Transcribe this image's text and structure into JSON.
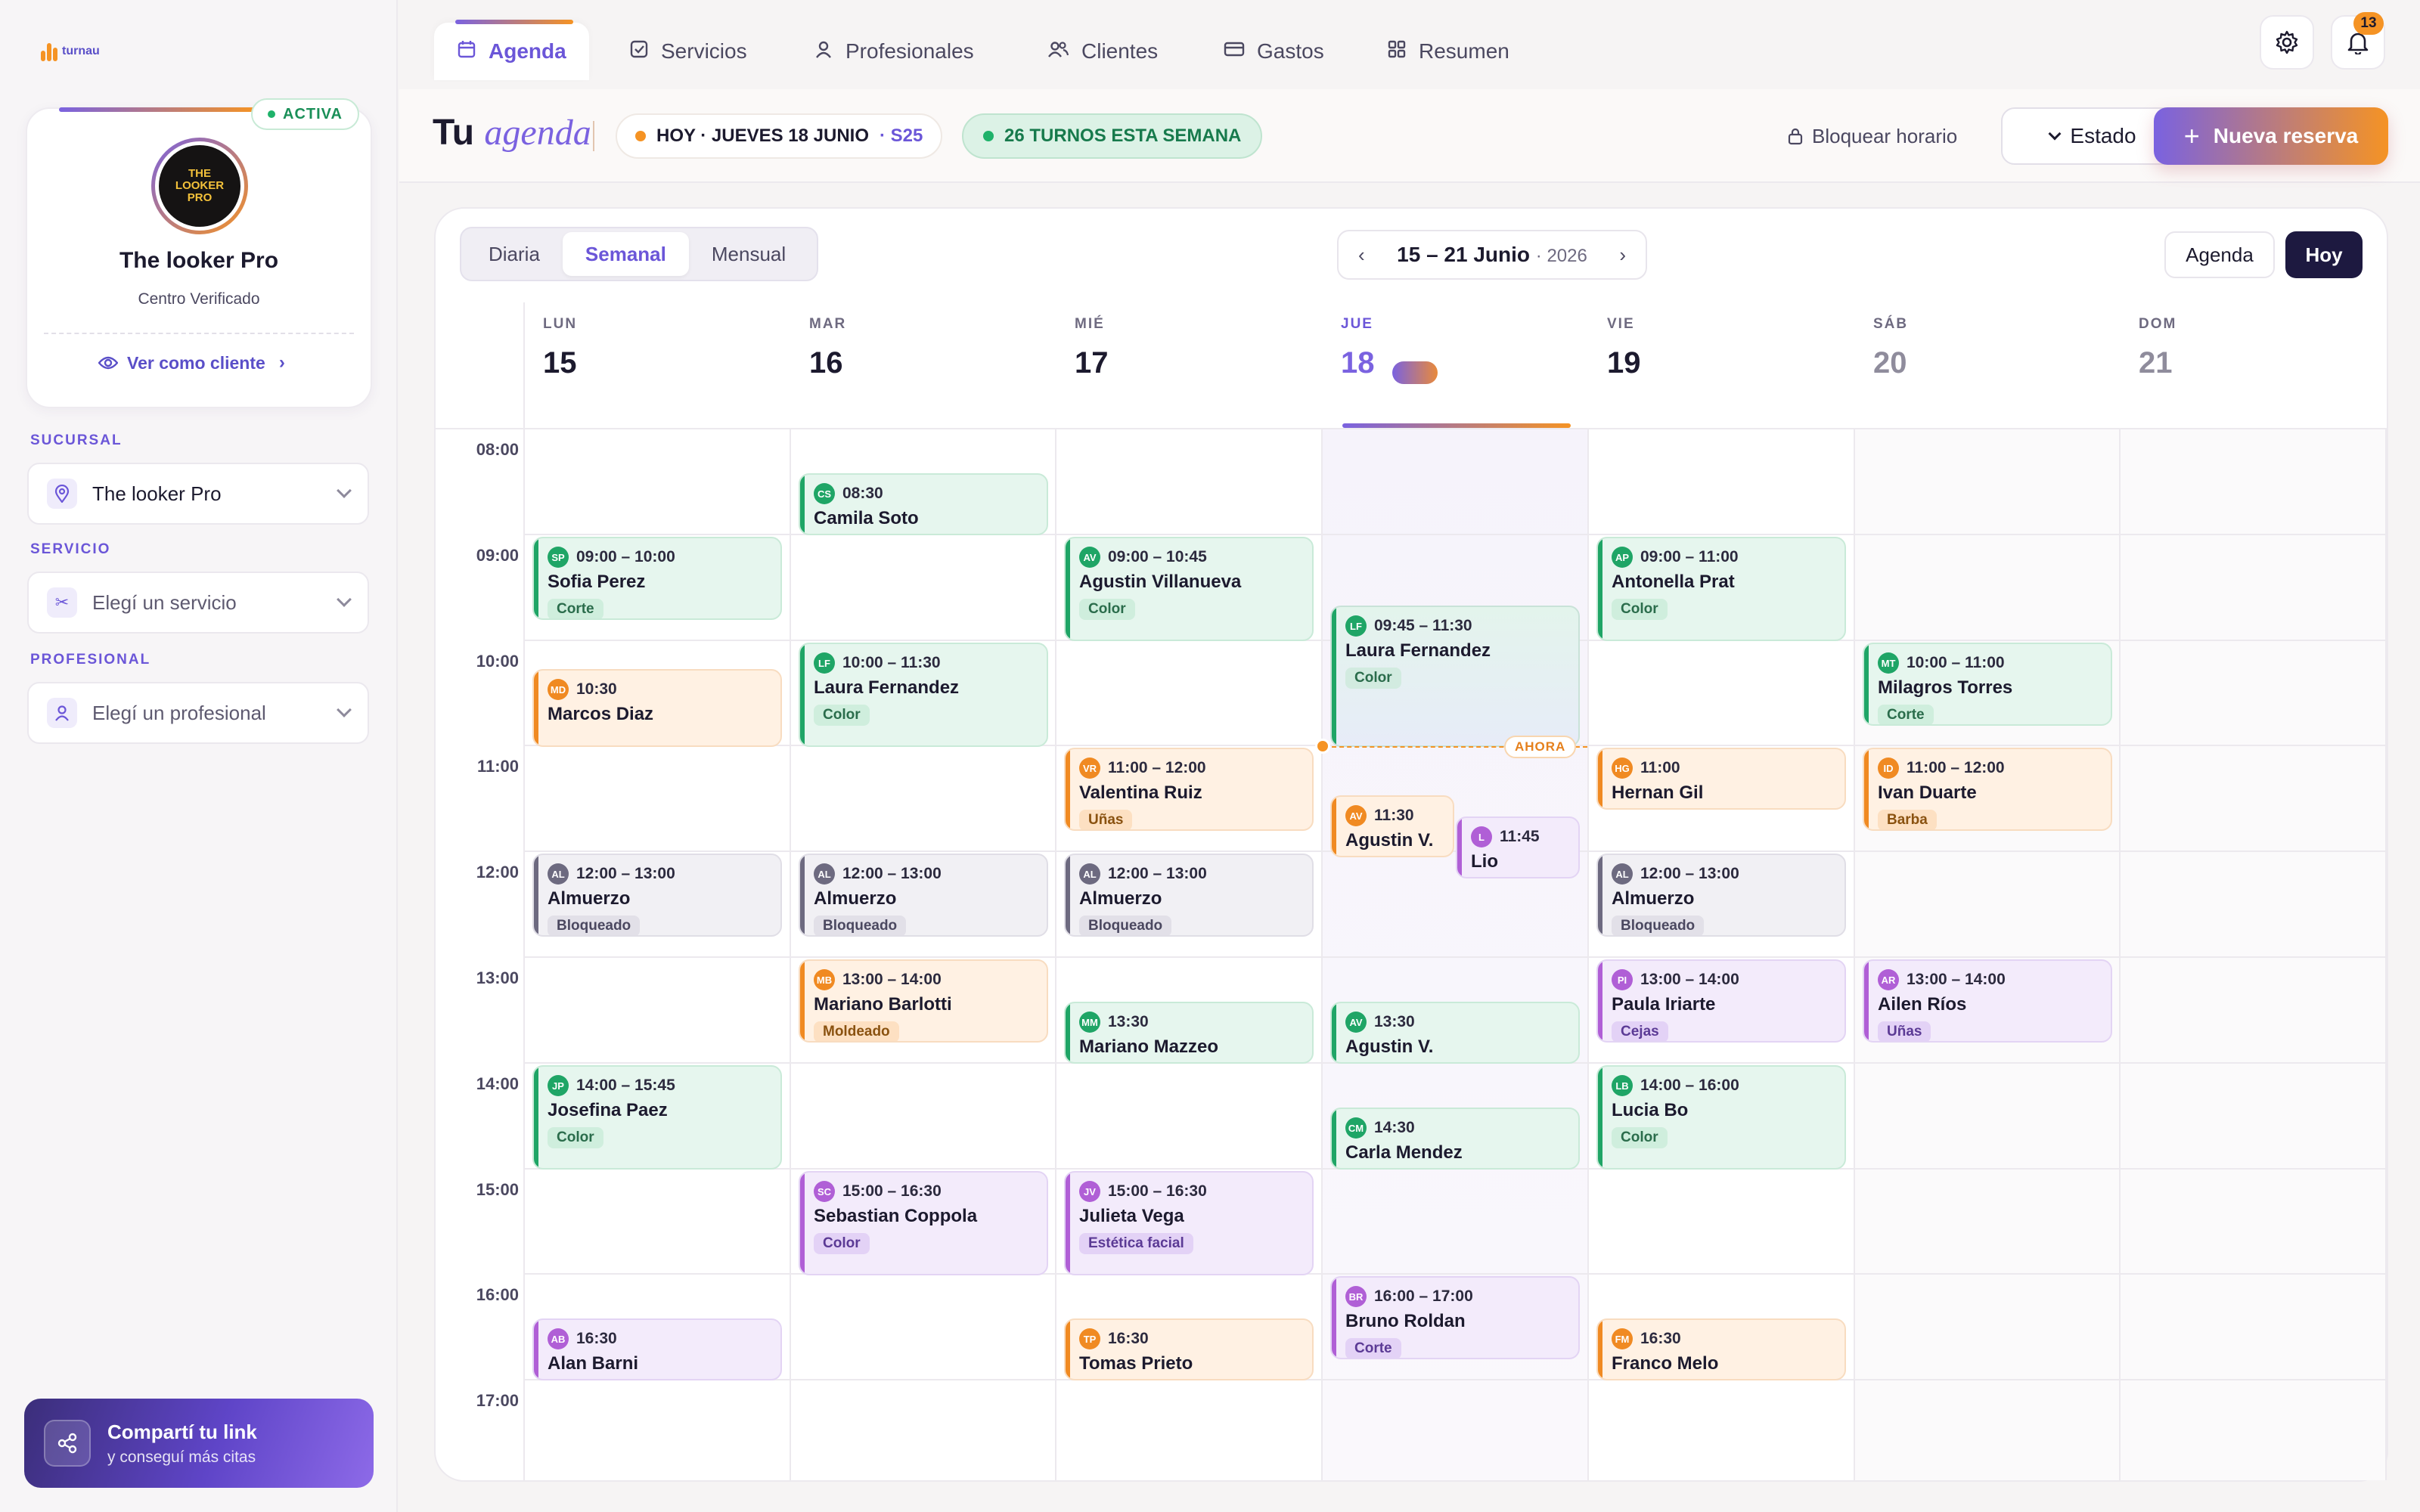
{
  "brand": {
    "name": "turnau"
  },
  "profile": {
    "status": "ACTIVA",
    "avatar_text": [
      "THE",
      "LOOKER",
      "PRO"
    ],
    "name": "The looker Pro",
    "subtitle": "Centro Verificado",
    "see_as_client": "Ver como cliente"
  },
  "filters": {
    "branch_label": "SUCURSAL",
    "branch_value": "The looker Pro",
    "service_label": "SERVICIO",
    "service_placeholder": "Elegí un servicio",
    "pro_label": "PROFESIONAL",
    "pro_placeholder": "Elegí un profesional"
  },
  "share": {
    "title": "Compartí tu link",
    "subtitle": "y conseguí más citas"
  },
  "nav": {
    "tabs": [
      {
        "label": "Agenda",
        "icon": "calendar-icon",
        "active": true
      },
      {
        "label": "Servicios",
        "icon": "checkbox-icon"
      },
      {
        "label": "Profesionales",
        "icon": "person-icon"
      },
      {
        "label": "Clientes",
        "icon": "people-icon"
      },
      {
        "label": "Gastos",
        "icon": "card-icon"
      },
      {
        "label": "Resumen",
        "icon": "grid-icon"
      }
    ],
    "notifications": "13"
  },
  "header": {
    "title_main": "Tu",
    "title_italic": "agenda",
    "today_text": "HOY · JUEVES 18 JUNIO",
    "week_code": "· S25",
    "week_turns": "26 TURNOS ESTA SEMANA",
    "block_label": "Bloquear horario",
    "estado_label": "Estado",
    "new_label": "Nueva reserva"
  },
  "calendar": {
    "views": [
      "Diaria",
      "Semanal",
      "Mensual"
    ],
    "active_view": "Semanal",
    "range": "15 – 21 Junio",
    "year": "· 2026",
    "agenda_btn": "Agenda",
    "hoy_btn": "Hoy",
    "now_label": "AHORA",
    "days": [
      {
        "abbr": "LUN",
        "num": "15"
      },
      {
        "abbr": "MAR",
        "num": "16"
      },
      {
        "abbr": "MIÉ",
        "num": "17"
      },
      {
        "abbr": "JUE",
        "num": "18",
        "today": true
      },
      {
        "abbr": "VIE",
        "num": "19"
      },
      {
        "abbr": "SÁB",
        "num": "20",
        "weekend": true
      },
      {
        "abbr": "DOM",
        "num": "21",
        "weekend": true
      }
    ],
    "hours": [
      "08:00",
      "09:00",
      "10:00",
      "11:00",
      "12:00",
      "13:00",
      "14:00",
      "15:00",
      "16:00",
      "17:00"
    ],
    "events": [
      {
        "day": 0,
        "start": 9.0,
        "end": 9.8,
        "time": "09:00 – 10:00",
        "initials": "SP",
        "name": "Sofia Perez",
        "tag": "Corte",
        "color": "green"
      },
      {
        "day": 0,
        "start": 10.25,
        "end": 11.0,
        "time": "10:30",
        "initials": "MD",
        "name": "Marcos Diaz",
        "color": "orange"
      },
      {
        "day": 0,
        "start": 12.0,
        "end": 12.8,
        "time": "12:00 – 13:00",
        "initials": "AL",
        "name": "Almuerzo",
        "tag": "Bloqueado",
        "color": "gray"
      },
      {
        "day": 0,
        "start": 14.0,
        "end": 15.0,
        "time": "14:00 – 15:45",
        "initials": "JP",
        "name": "Josefina Paez",
        "tag": "Color",
        "color": "green"
      },
      {
        "day": 0,
        "start": 16.4,
        "end": 17.0,
        "time": "16:30",
        "initials": "AB",
        "name": "Alan Barni",
        "color": "purple"
      },
      {
        "day": 1,
        "start": 8.4,
        "end": 9.0,
        "time": "08:30",
        "initials": "CS",
        "name": "Camila Soto",
        "color": "green"
      },
      {
        "day": 1,
        "start": 10.0,
        "end": 11.0,
        "time": "10:00 – 11:30",
        "initials": "LF",
        "name": "Laura Fernandez",
        "tag": "Color",
        "color": "green"
      },
      {
        "day": 1,
        "start": 12.0,
        "end": 12.8,
        "time": "12:00 – 13:00",
        "initials": "AL",
        "name": "Almuerzo",
        "tag": "Bloqueado",
        "color": "gray"
      },
      {
        "day": 1,
        "start": 13.0,
        "end": 13.8,
        "time": "13:00 – 14:00",
        "initials": "MB",
        "name": "Mariano Barlotti",
        "tag": "Moldeado",
        "color": "orange"
      },
      {
        "day": 1,
        "start": 15.0,
        "end": 16.0,
        "time": "15:00 – 16:30",
        "initials": "SC",
        "name": "Sebastian Coppola",
        "tag": "Color",
        "color": "purple"
      },
      {
        "day": 2,
        "start": 9.0,
        "end": 10.0,
        "time": "09:00 – 10:45",
        "initials": "AV",
        "name": "Agustin Villanueva",
        "tag": "Color",
        "color": "green"
      },
      {
        "day": 2,
        "start": 11.0,
        "end": 11.8,
        "time": "11:00 – 12:00",
        "initials": "VR",
        "name": "Valentina Ruiz",
        "tag": "Uñas",
        "color": "orange"
      },
      {
        "day": 2,
        "start": 12.0,
        "end": 12.8,
        "time": "12:00 – 13:00",
        "initials": "AL",
        "name": "Almuerzo",
        "tag": "Bloqueado",
        "color": "gray"
      },
      {
        "day": 2,
        "start": 13.4,
        "end": 14.0,
        "time": "13:30",
        "initials": "MM",
        "name": "Mariano Mazzeo",
        "color": "green"
      },
      {
        "day": 2,
        "start": 15.0,
        "end": 16.0,
        "time": "15:00 – 16:30",
        "initials": "JV",
        "name": "Julieta Vega",
        "tag": "Estética facial",
        "color": "purple"
      },
      {
        "day": 2,
        "start": 16.4,
        "end": 17.0,
        "time": "16:30",
        "initials": "TP",
        "name": "Tomas Prieto",
        "color": "orange"
      },
      {
        "day": 3,
        "start": 9.65,
        "end": 11.0,
        "time": "09:45 – 11:30",
        "initials": "LF",
        "name": "Laura Fernandez",
        "tag": "Color",
        "color": "green-blue"
      },
      {
        "day": 3,
        "start": 11.45,
        "end": 12.05,
        "time": "11:30",
        "initials": "AV",
        "name": "Agustin V.",
        "color": "orange",
        "half": "left"
      },
      {
        "day": 3,
        "start": 11.65,
        "end": 12.25,
        "time": "11:45",
        "initials": "L",
        "name": "Lio",
        "color": "purple",
        "half": "right"
      },
      {
        "day": 3,
        "start": 13.4,
        "end": 14.0,
        "time": "13:30",
        "initials": "AV",
        "name": "Agustin V.",
        "color": "green"
      },
      {
        "day": 3,
        "start": 14.4,
        "end": 15.0,
        "time": "14:30",
        "initials": "CM",
        "name": "Carla Mendez",
        "color": "green"
      },
      {
        "day": 3,
        "start": 16.0,
        "end": 16.8,
        "time": "16:00 – 17:00",
        "initials": "BR",
        "name": "Bruno Roldan",
        "tag": "Corte",
        "color": "purple"
      },
      {
        "day": 4,
        "start": 9.0,
        "end": 10.0,
        "time": "09:00 – 11:00",
        "initials": "AP",
        "name": "Antonella Prat",
        "tag": "Color",
        "color": "green"
      },
      {
        "day": 4,
        "start": 11.0,
        "end": 11.6,
        "time": "11:00",
        "initials": "HG",
        "name": "Hernan Gil",
        "color": "orange"
      },
      {
        "day": 4,
        "start": 12.0,
        "end": 12.8,
        "time": "12:00 – 13:00",
        "initials": "AL",
        "name": "Almuerzo",
        "tag": "Bloqueado",
        "color": "gray"
      },
      {
        "day": 4,
        "start": 13.0,
        "end": 13.8,
        "time": "13:00 – 14:00",
        "initials": "PI",
        "name": "Paula Iriarte",
        "tag": "Cejas",
        "color": "purple"
      },
      {
        "day": 4,
        "start": 14.0,
        "end": 15.0,
        "time": "14:00 – 16:00",
        "initials": "LB",
        "name": "Lucia Bo",
        "tag": "Color",
        "color": "green"
      },
      {
        "day": 4,
        "start": 16.4,
        "end": 17.0,
        "time": "16:30",
        "initials": "FM",
        "name": "Franco Melo",
        "color": "orange"
      },
      {
        "day": 5,
        "start": 10.0,
        "end": 10.8,
        "time": "10:00 – 11:00",
        "initials": "MT",
        "name": "Milagros Torres",
        "tag": "Corte",
        "color": "green"
      },
      {
        "day": 5,
        "start": 11.0,
        "end": 11.8,
        "time": "11:00 – 12:00",
        "initials": "ID",
        "name": "Ivan Duarte",
        "tag": "Barba",
        "color": "orange"
      },
      {
        "day": 5,
        "start": 13.0,
        "end": 13.8,
        "time": "13:00 – 14:00",
        "initials": "AR",
        "name": "Ailen Ríos",
        "tag": "Uñas",
        "color": "purple"
      }
    ]
  }
}
